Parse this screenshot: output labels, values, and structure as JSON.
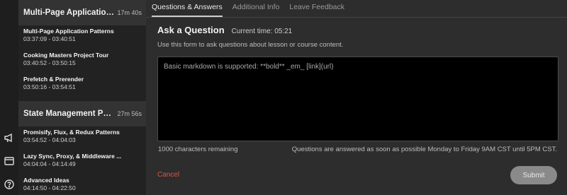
{
  "sidebar": {
    "sections": [
      {
        "title": "Multi-Page Application ...",
        "duration": "17m 40s",
        "lessons": [
          {
            "title": "Multi-Page Application Patterns",
            "time": "03:37:09 - 03:40:51"
          },
          {
            "title": "Cooking Masters Project Tour",
            "time": "03:40:52 - 03:50:15"
          },
          {
            "title": "Prefetch & Prerender",
            "time": "03:50:16 - 03:54:51"
          }
        ]
      },
      {
        "title": "State Management Patt...",
        "duration": "27m 56s",
        "lessons": [
          {
            "title": "Promisify, Flux, & Redux Patterns",
            "time": "03:54:52 - 04:04:03"
          },
          {
            "title": "Lazy Sync, Proxy, & Middleware ...",
            "time": "04:04:04 - 04:14:49"
          },
          {
            "title": "Advanced Ideas",
            "time": "04:14:50 - 04:22:50"
          }
        ]
      }
    ]
  },
  "rail": {
    "icons": [
      "megaphone-icon",
      "window-icon",
      "help-icon"
    ]
  },
  "tabs": [
    {
      "label": "Questions & Answers",
      "active": true
    },
    {
      "label": "Additional Info",
      "active": false
    },
    {
      "label": "Leave Feedback",
      "active": false
    }
  ],
  "form": {
    "heading": "Ask a Question",
    "current_time": "Current time: 05:21",
    "instructions": "Use this form to ask questions about lesson or course content.",
    "placeholder": "Basic markdown is supported: **bold** _em_ [link](url)",
    "value": "",
    "remaining": "1000 characters remaining",
    "answer_note": "Questions are answered as soon as possible Monday to Friday 9AM CST until 5PM CST.",
    "cancel_label": "Cancel",
    "submit_label": "Submit"
  },
  "colors": {
    "cancel": "#e0533e",
    "submit_bg": "#8a8a8a",
    "textarea_bg": "#000000"
  }
}
